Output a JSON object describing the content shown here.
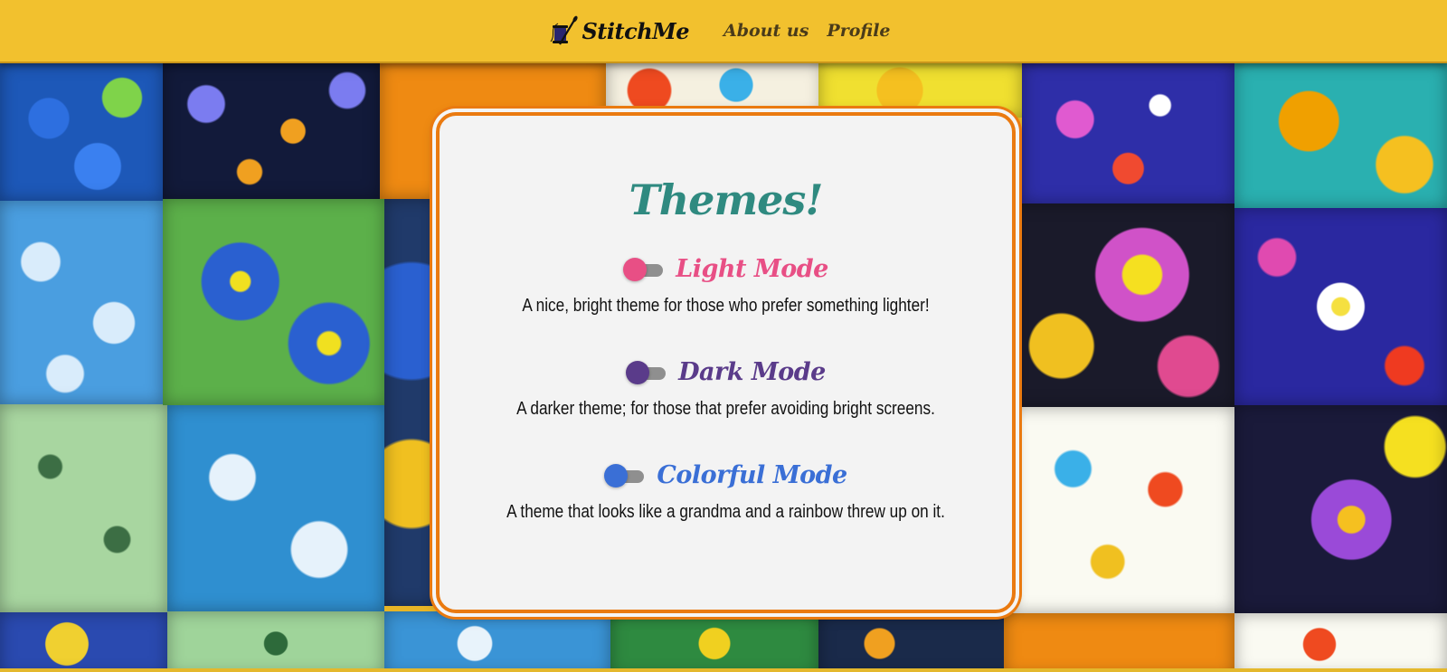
{
  "header": {
    "brand": "StitchMe",
    "nav": [
      {
        "label": "About us"
      },
      {
        "label": "Profile"
      }
    ]
  },
  "card": {
    "title": "Themes!",
    "themes": [
      {
        "name": "Light Mode",
        "description": "A nice, bright theme for those who prefer something lighter!",
        "color": "#e84f85",
        "enabled": false
      },
      {
        "name": "Dark Mode",
        "description": "A darker theme; for those that prefer avoiding bright screens.",
        "color": "#5a3b8a",
        "enabled": false
      },
      {
        "name": "Colorful Mode",
        "description": "A theme that looks like a grandma and a rainbow threw up on it.",
        "color": "#3a6fd6",
        "enabled": false
      }
    ]
  },
  "colors": {
    "header_bg": "#f2c12e",
    "card_border": "#ea7a10",
    "title": "#2f8a80",
    "toggle_track": "#8f8f8f"
  }
}
